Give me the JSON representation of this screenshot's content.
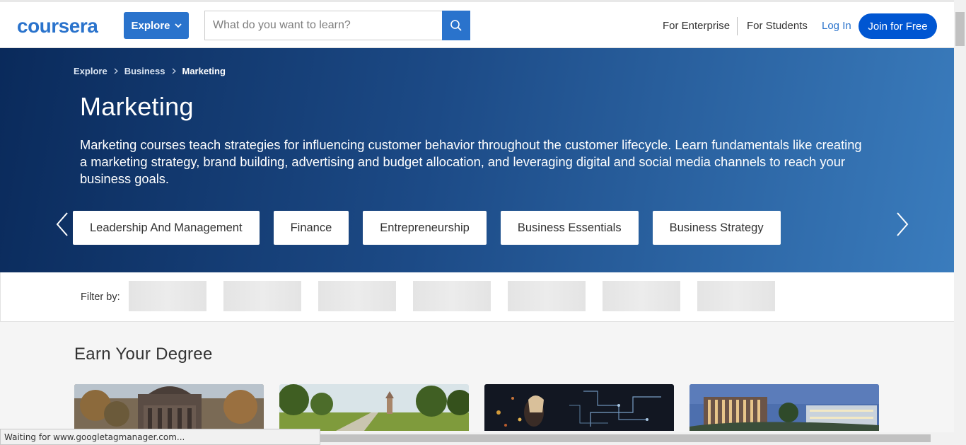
{
  "brand": {
    "logo_text": "coursera",
    "accent": "#2a73cc",
    "join_color": "#0056d2"
  },
  "header": {
    "explore_label": "Explore",
    "search": {
      "placeholder": "What do you want to learn?",
      "value": ""
    },
    "nav": {
      "enterprise": "For Enterprise",
      "students": "For Students",
      "login": "Log In",
      "join": "Join for Free"
    }
  },
  "hero": {
    "breadcrumb": [
      "Explore",
      "Business",
      "Marketing"
    ],
    "title": "Marketing",
    "description": "Marketing courses teach strategies for influencing customer behavior throughout the customer lifecycle. Learn fundamentals like creating a marketing strategy, brand building, advertising and budget allocation, and leveraging digital and social media channels to reach your business goals.",
    "topics": [
      "Leadership And Management",
      "Finance",
      "Entrepreneurship",
      "Business Essentials",
      "Business Strategy"
    ]
  },
  "filter": {
    "label": "Filter by:",
    "placeholder_count": 7
  },
  "degrees": {
    "title": "Earn Your Degree"
  },
  "browser": {
    "status_text": "Waiting for www.googletagmanager.com..."
  },
  "icons": [
    "search-icon",
    "chevron-down-icon",
    "chevron-right-icon",
    "arrow-left-icon",
    "arrow-right-icon"
  ]
}
